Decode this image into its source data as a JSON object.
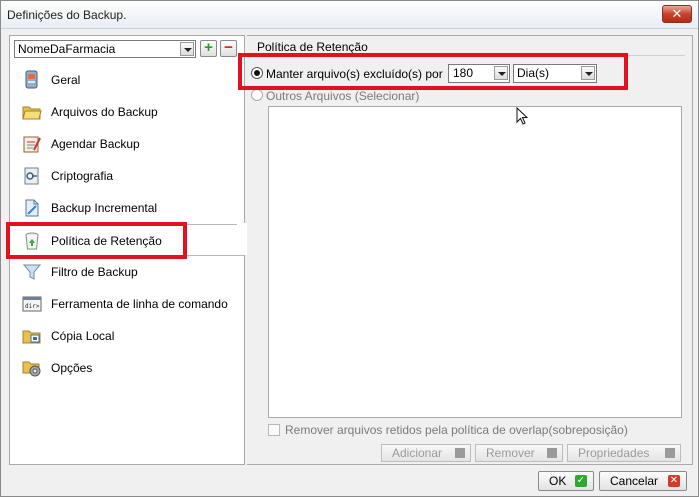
{
  "window": {
    "title": "Definições do Backup."
  },
  "profile": {
    "selected": "NomeDaFarmacia"
  },
  "nav": {
    "items": [
      {
        "label": "Geral",
        "icon": "general-icon"
      },
      {
        "label": "Arquivos do Backup",
        "icon": "folder-icon"
      },
      {
        "label": "Agendar Backup",
        "icon": "schedule-icon"
      },
      {
        "label": "Criptografia",
        "icon": "encryption-icon"
      },
      {
        "label": "Backup Incremental",
        "icon": "incremental-icon"
      },
      {
        "label": "Política de Retenção",
        "icon": "recycle-bin-icon",
        "selected": true
      },
      {
        "label": "Filtro de Backup",
        "icon": "filter-icon"
      },
      {
        "label": "Ferramenta de linha de comando",
        "icon": "command-line-icon"
      },
      {
        "label": "Cópia Local",
        "icon": "local-copy-icon"
      },
      {
        "label": "Opções",
        "icon": "options-gear-icon"
      }
    ]
  },
  "retention": {
    "group_title": "Política de Retenção",
    "keep_label": "Manter arquivo(s) excluído(s) por",
    "keep_value": "180",
    "unit_value": "Dia(s)",
    "other_label": "Outros Arquivos (Selecionar)",
    "remove_label": "Remover arquivos retidos  pela política de overlap(sobreposição)",
    "buttons": {
      "add": "Adicionar",
      "remove": "Remover",
      "properties": "Propriedades"
    }
  },
  "footer": {
    "ok": "OK",
    "cancel": "Cancelar"
  },
  "colors": {
    "highlight": "#e0121e",
    "accent_green": "#2fa82f",
    "accent_red": "#d23a2a"
  }
}
